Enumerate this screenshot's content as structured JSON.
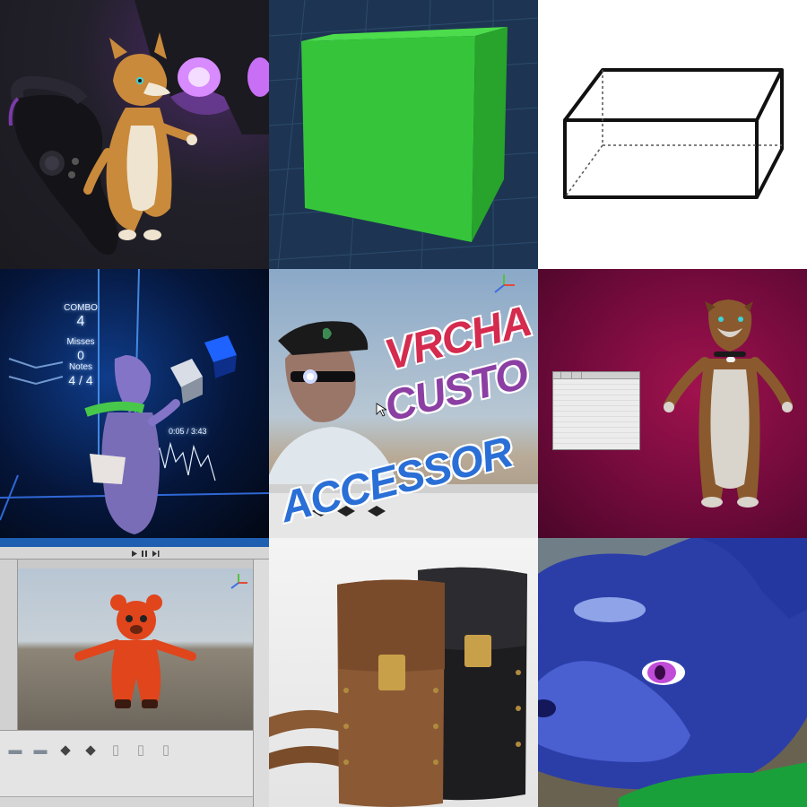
{
  "tiles": [
    {
      "id": 1,
      "subject": "Fox avatar standing beside a VR headset and controller"
    },
    {
      "id": 2,
      "subject": "Green cube in a Unity scene"
    },
    {
      "id": 3,
      "subject": "Wireframe rectangular box line drawing"
    },
    {
      "id": 4,
      "subject": "Beat Saber gameplay with avatar",
      "hud": {
        "combo_label": "COMBO",
        "combo_value": "4",
        "misses_label": "Misses",
        "misses_value": "0",
        "notes_label": "Notes",
        "notes_value": "4 / 4",
        "song_time": "0:05 / 3:43"
      }
    },
    {
      "id": 5,
      "subject": "VRChat custom accessories thumbnail",
      "title_lines": [
        "VRCHA",
        "CUSTO",
        "ACCESSOR"
      ]
    },
    {
      "id": 6,
      "subject": "Dog avatar in T-pose with editor window"
    },
    {
      "id": 7,
      "subject": "Unity editor with red bear avatar in T-pose"
    },
    {
      "id": 8,
      "subject": "Brown and black leather belt pouches"
    },
    {
      "id": 9,
      "subject": "Close-up of blue furry avatar face"
    }
  ],
  "colors": {
    "cube_green": "#36c53a",
    "title_red": "#d42b4e",
    "title_purple": "#8b3fa3",
    "title_blue": "#2a6fd6",
    "magenta_bg": "#a0124e",
    "unity_blue": "#1e5fb2"
  },
  "icons": [
    "unity-logo-icon",
    "folder-icon",
    "document-icon",
    "play-icon",
    "pause-icon",
    "step-icon",
    "gizmo-icon",
    "cursor-icon"
  ]
}
